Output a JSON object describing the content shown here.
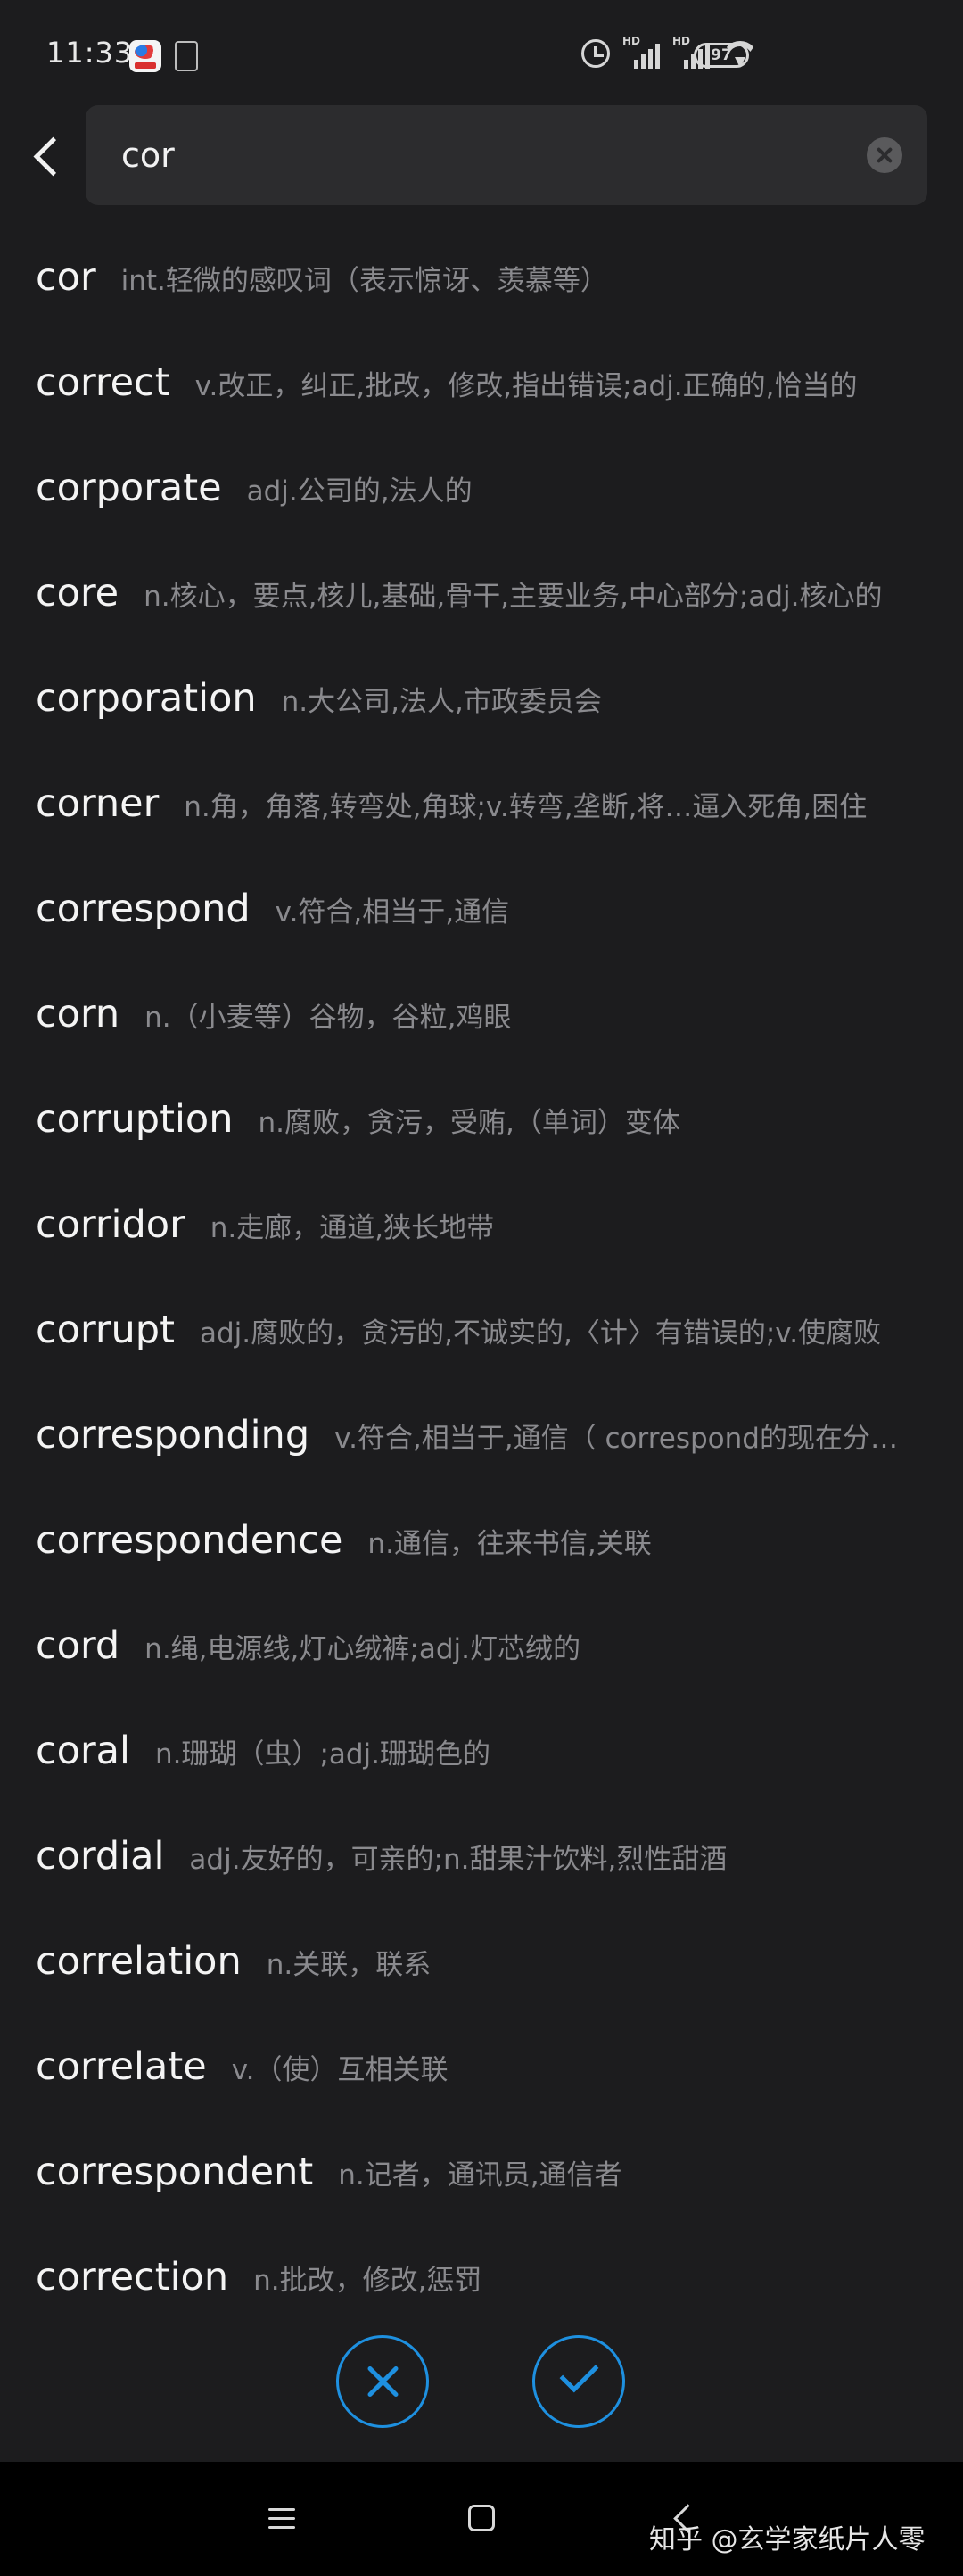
{
  "status_bar": {
    "time": "11:33",
    "battery": "97",
    "signal_label": "HD"
  },
  "search": {
    "value": "cor"
  },
  "results": [
    {
      "word": "cor",
      "definition": "int.轻微的感叹词（表示惊讶、羡慕等）"
    },
    {
      "word": "correct",
      "definition": "v.改正，纠正,批改，修改,指出错误;adj.正确的,恰当的"
    },
    {
      "word": "corporate",
      "definition": "adj.公司的,法人的"
    },
    {
      "word": "core",
      "definition": "n.核心，要点,核儿,基础,骨干,主要业务,中心部分;adj.核心的"
    },
    {
      "word": "corporation",
      "definition": "n.大公司,法人,市政委员会"
    },
    {
      "word": "corner",
      "definition": "n.角，角落,转弯处,角球;v.转弯,垄断,将…逼入死角,困住"
    },
    {
      "word": "correspond",
      "definition": "v.符合,相当于,通信"
    },
    {
      "word": "corn",
      "definition": "n.（小麦等）谷物，谷粒,鸡眼"
    },
    {
      "word": "corruption",
      "definition": "n.腐败，贪污，受贿,（单词）变体"
    },
    {
      "word": "corridor",
      "definition": "n.走廊，通道,狭长地带"
    },
    {
      "word": "corrupt",
      "definition": "adj.腐败的，贪污的,不诚实的,〈计〉有错误的;v.使腐败"
    },
    {
      "word": "corresponding",
      "definition": "v.符合,相当于,通信（ correspond的现在分词 ）"
    },
    {
      "word": "correspondence",
      "definition": "n.通信，往来书信,关联"
    },
    {
      "word": "cord",
      "definition": "n.绳,电源线,灯心绒裤;adj.灯芯绒的"
    },
    {
      "word": "coral",
      "definition": "n.珊瑚（虫）;adj.珊瑚色的"
    },
    {
      "word": "cordial",
      "definition": "adj.友好的，可亲的;n.甜果汁饮料,烈性甜酒"
    },
    {
      "word": "correlation",
      "definition": "n.关联，联系"
    },
    {
      "word": "correlate",
      "definition": "v.（使）互相关联"
    },
    {
      "word": "correspondent",
      "definition": "n.记者，通讯员,通信者"
    },
    {
      "word": "correction",
      "definition": "n.批改，修改,惩罚"
    }
  ],
  "watermark": "知乎 @玄学家纸片人零",
  "colors": {
    "background": "#1c1c1e",
    "accent": "#1e90e0",
    "definition_text": "#8a8a8e"
  },
  "icons": {
    "back": "back-arrow-icon",
    "clear": "clear-circle-icon",
    "cancel": "x-icon",
    "confirm": "check-icon"
  }
}
